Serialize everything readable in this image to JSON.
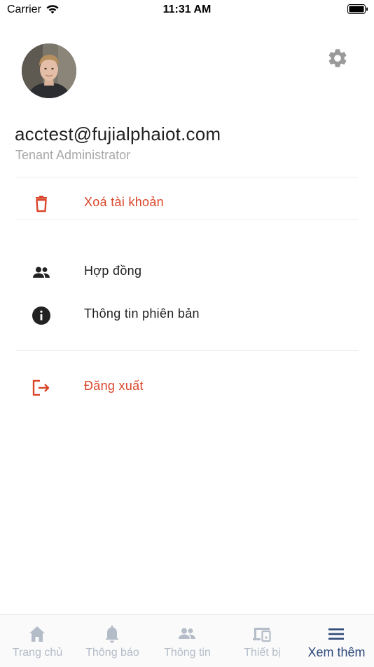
{
  "status_bar": {
    "carrier": "Carrier",
    "time": "11:31 AM"
  },
  "profile": {
    "email": "acctest@fujialphaiot.com",
    "role": "Tenant Administrator"
  },
  "menu": {
    "delete_account": "Xoá tài khoản",
    "contract": "Hợp đồng",
    "version_info": "Thông tin phiên bản",
    "logout": "Đăng xuất"
  },
  "tabs": [
    {
      "label": "Trang chủ",
      "icon": "home-icon"
    },
    {
      "label": "Thông báo",
      "icon": "bell-icon"
    },
    {
      "label": "Thông tin",
      "icon": "people-icon"
    },
    {
      "label": "Thiết bị",
      "icon": "devices-icon"
    },
    {
      "label": "Xem thêm",
      "icon": "menu-icon"
    }
  ],
  "colors": {
    "danger": "#d9472b",
    "active_tab": "#2f4a7a",
    "inactive_tab": "#b4bcc8"
  }
}
